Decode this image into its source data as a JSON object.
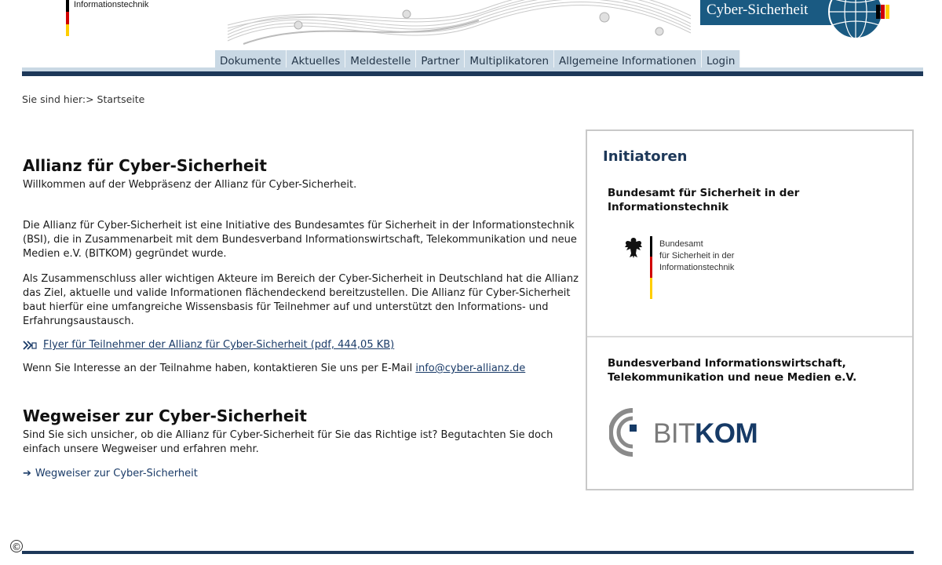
{
  "header": {
    "logo_text": "Informationstechnik",
    "brand_label": "Cyber-Sicherheit"
  },
  "nav": {
    "tabs": [
      "Dokumente",
      "Aktuelles",
      "Meldestelle",
      "Partner",
      "Multiplikatoren",
      "Allgemeine Informationen",
      "Login"
    ]
  },
  "breadcrumb": "Sie sind hier:> Startseite",
  "main": {
    "title": "Allianz für Cyber-Sicherheit",
    "welcome": "Willkommen auf der Webpräsenz der Allianz für Cyber-Sicherheit.",
    "para1": "Die Allianz für Cyber-Sicherheit ist eine Initiative des Bundesamtes für Sicherheit in der Informationstechnik (BSI), die in Zusammenarbeit mit dem Bundesverband Informationswirtschaft, Telekommunikation und neue Medien e.V. (BITKOM) gegründet wurde.",
    "para2": "Als Zusammenschluss aller wichtigen Akteure im Bereich der Cyber-Sicherheit in Deutschland hat die Allianz das Ziel, aktuelle und valide Informationen flächendeckend bereitzustellen. Die Allianz für Cyber-Sicherheit baut hierfür eine umfangreiche Wissensbasis für Teilnehmer auf und unterstützt den Informations- und Erfahrungsaustausch.",
    "flyer_link": "Flyer für Teilnehmer der Allianz für Cyber-Sicherheit (pdf, 444,05 KB)",
    "contact_text": "Wenn Sie Interesse an der Teilnahme haben, kontaktieren Sie uns per E-Mail ",
    "contact_email": "info@cyber-allianz.de",
    "section2_title": "Wegweiser zur Cyber-Sicherheit",
    "section2_text": "Sind Sie sich unsicher, ob die Allianz für Cyber-Sicherheit für Sie das Richtige ist? Begutachten Sie doch einfach unsere Wegweiser und erfahren mehr.",
    "section2_link": "Wegweiser zur Cyber-Sicherheit"
  },
  "sidebar": {
    "title": "Initiatoren",
    "org1_line1": "Bundesamt für Sicherheit in der",
    "org1_line2": "Informationstechnik",
    "bsi_logo_line1": "Bundesamt",
    "bsi_logo_line2": "für Sicherheit in der",
    "bsi_logo_line3": "Informationstechnik",
    "org2_line1": "Bundesverband Informationswirtschaft,",
    "org2_line2": "Telekommunikation und neue Medien e.V.",
    "bitkom_part1": "BIT",
    "bitkom_part2": "KOM"
  },
  "footer": {
    "copyright_symbol": "©"
  },
  "colors": {
    "navy": "#1d3859",
    "nav_tab": "#c9d8e4",
    "brand_blue": "#1a5a82",
    "link": "#1a3b68"
  }
}
